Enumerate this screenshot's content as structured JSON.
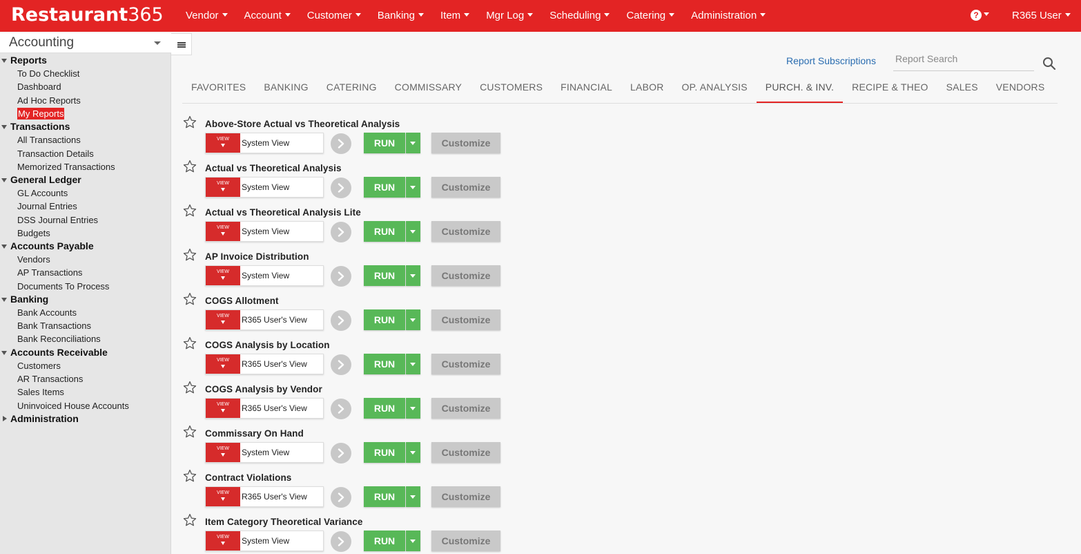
{
  "app": {
    "logo_bold": "Restaurant",
    "logo_light": "365"
  },
  "nav": {
    "items": [
      "Vendor",
      "Account",
      "Customer",
      "Banking",
      "Item",
      "Mgr Log",
      "Scheduling",
      "Catering",
      "Administration"
    ],
    "help_icon": "question-circle-icon",
    "user": "R365 User"
  },
  "sidebar": {
    "module": "Accounting",
    "sections": [
      {
        "label": "Reports",
        "expanded": true,
        "items": [
          "To Do Checklist",
          "Dashboard",
          "Ad Hoc Reports",
          "My Reports"
        ]
      },
      {
        "label": "Transactions",
        "expanded": true,
        "items": [
          "All Transactions",
          "Transaction Details",
          "Memorized Transactions"
        ]
      },
      {
        "label": "General Ledger",
        "expanded": true,
        "items": [
          "GL Accounts",
          "Journal Entries",
          "DSS Journal Entries",
          "Budgets"
        ]
      },
      {
        "label": "Accounts Payable",
        "expanded": true,
        "items": [
          "Vendors",
          "AP Transactions",
          "Documents To Process"
        ]
      },
      {
        "label": "Banking",
        "expanded": true,
        "items": [
          "Bank Accounts",
          "Bank Transactions",
          "Bank Reconciliations"
        ]
      },
      {
        "label": "Accounts Receivable",
        "expanded": true,
        "items": [
          "Customers",
          "AR Transactions",
          "Sales Items",
          "Uninvoiced House Accounts"
        ]
      },
      {
        "label": "Administration",
        "expanded": false,
        "items": []
      }
    ],
    "selected": "My Reports"
  },
  "main": {
    "subscriptions_link": "Report Subscriptions",
    "search_placeholder": "Report Search",
    "tabs": [
      "FAVORITES",
      "BANKING",
      "CATERING",
      "COMMISSARY",
      "CUSTOMERS",
      "FINANCIAL",
      "LABOR",
      "OP. ANALYSIS",
      "PURCH. & INV.",
      "RECIPE & THEO",
      "SALES",
      "VENDORS"
    ],
    "active_tab": "PURCH. & INV.",
    "view_label": "VIEW",
    "run_label": "RUN",
    "customize_label": "Customize",
    "reports": [
      {
        "title": "Above-Store Actual vs Theoretical Analysis",
        "view": "System View"
      },
      {
        "title": "Actual vs Theoretical Analysis",
        "view": "System View"
      },
      {
        "title": "Actual vs Theoretical Analysis Lite",
        "view": "System View"
      },
      {
        "title": "AP Invoice Distribution",
        "view": "System View"
      },
      {
        "title": "COGS Allotment",
        "view": "R365 User's View"
      },
      {
        "title": "COGS Analysis by Location",
        "view": "R365 User's View"
      },
      {
        "title": "COGS Analysis by Vendor",
        "view": "R365 User's View"
      },
      {
        "title": "Commissary On Hand",
        "view": "System View"
      },
      {
        "title": "Contract Violations",
        "view": "R365 User's View"
      },
      {
        "title": "Item Category Theoretical Variance",
        "view": "System View"
      }
    ]
  },
  "colors": {
    "brand_red": "#e32424",
    "run_green": "#58b858",
    "link_blue": "#2a6db0",
    "disabled_gray": "#c9c9c9"
  }
}
